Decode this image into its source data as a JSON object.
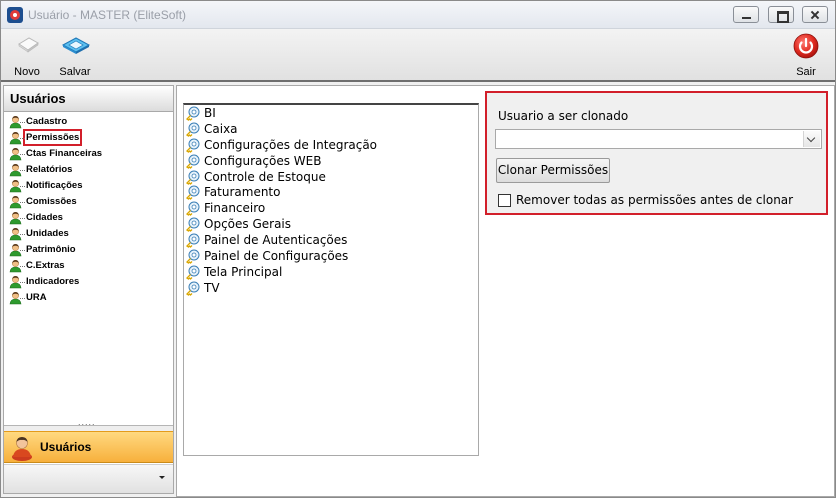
{
  "window": {
    "title": "Usuário - MASTER (EliteSoft)"
  },
  "toolbar": {
    "novo_label": "Novo",
    "salvar_label": "Salvar",
    "sair_label": "Sair"
  },
  "sidebar": {
    "header": "Usuários",
    "items": [
      {
        "label": "Cadastro",
        "icon": "user-icon"
      },
      {
        "label": "Permissões",
        "icon": "user-icon",
        "selected": true
      },
      {
        "label": "Ctas Financeiras",
        "icon": "user-icon"
      },
      {
        "label": "Relatórios",
        "icon": "user-icon"
      },
      {
        "label": "Notificações",
        "icon": "user-icon"
      },
      {
        "label": "Comissões",
        "icon": "user-icon"
      },
      {
        "label": "Cidades",
        "icon": "user-icon"
      },
      {
        "label": "Unidades",
        "icon": "user-icon"
      },
      {
        "label": "Patrimônio",
        "icon": "user-icon"
      },
      {
        "label": "C.Extras",
        "icon": "user-icon"
      },
      {
        "label": "Indicadores",
        "icon": "user-icon"
      },
      {
        "label": "URA",
        "icon": "user-icon"
      }
    ],
    "module_label": "Usuários"
  },
  "permissions": {
    "items": [
      "BI",
      "Caixa",
      "Configurações de Integração",
      "Configurações WEB",
      "Controle de Estoque",
      "Faturamento",
      "Financeiro",
      "Opções Gerais",
      "Painel de Autenticações",
      "Painel de Configurações",
      "Tela Principal",
      "TV"
    ]
  },
  "clone": {
    "label": "Usuario a ser clonado",
    "selected_value": "",
    "button_label": "Clonar Permissões",
    "checkbox_label": "Remover todas as permissões antes de clonar",
    "checkbox_checked": false
  },
  "colors": {
    "highlight": "#d21f2a",
    "module_active": "#f7b03c"
  }
}
